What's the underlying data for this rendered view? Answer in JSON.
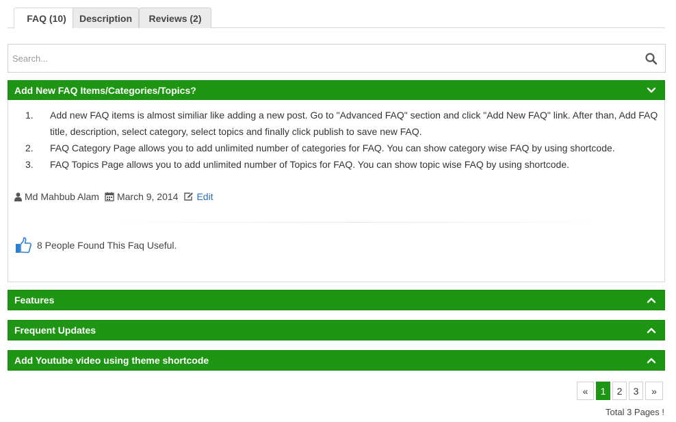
{
  "tabs": [
    {
      "label": "FAQ (10)",
      "active": true
    },
    {
      "label": "Description",
      "active": false
    },
    {
      "label": "Reviews (2)",
      "active": false
    }
  ],
  "search": {
    "placeholder": "Search...",
    "icon": "search-icon"
  },
  "colors": {
    "accent": "#1e9614",
    "link": "#2a6db6",
    "useful_icon": "#2a7fd4"
  },
  "faq_sections": [
    {
      "title": "Add New FAQ Items/Categories/Topics?",
      "expanded": true,
      "items": [
        {
          "num": "1.",
          "text": "Add new FAQ items is almost similiar like adding a new post. Go to \"Advanced FAQ\" section and click \"Add New FAQ\" link. After than, Add FAQ title, description, select category, select topics and finally click publish to save new FAQ."
        },
        {
          "num": "2.",
          "text": "FAQ Category Page allows you to add unlimited number of categories for FAQ. You can show category wise FAQ by using shortcode."
        },
        {
          "num": "3.",
          "text": "FAQ Topics Page allows you to add unlimited number of Topics for FAQ. You can show topic wise FAQ by using shortcode."
        }
      ],
      "author": "Md Mahbub Alam",
      "date": "March 9, 2014",
      "edit_label": "Edit",
      "useful_text": "8 People Found This Faq Useful."
    },
    {
      "title": "Features",
      "expanded": false
    },
    {
      "title": "Frequent Updates",
      "expanded": false
    },
    {
      "title": "Add Youtube video using theme shortcode",
      "expanded": false
    }
  ],
  "pagination": {
    "prev": "«",
    "pages": [
      "1",
      "2",
      "3"
    ],
    "current": "1",
    "next": "»",
    "total_text": "Total 3 Pages !"
  }
}
